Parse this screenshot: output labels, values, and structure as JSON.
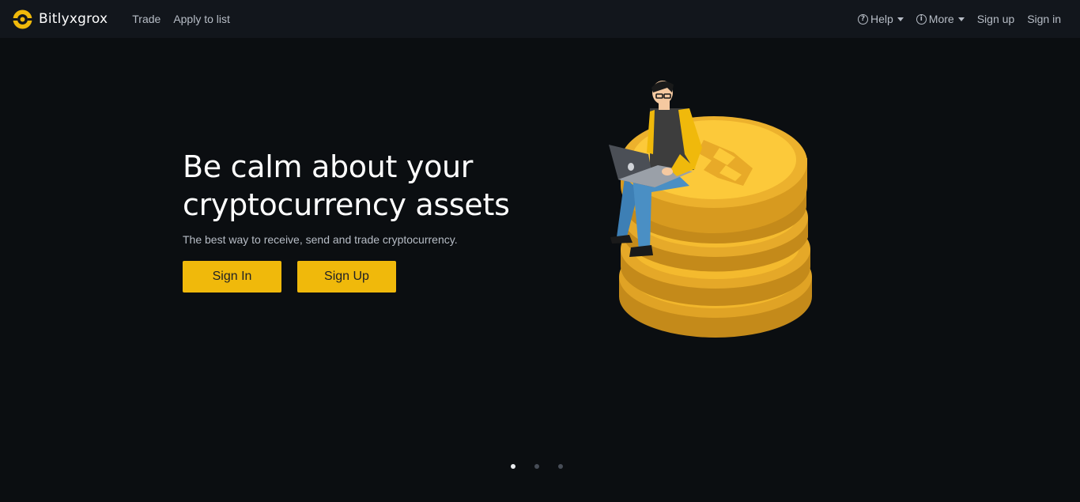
{
  "brand": {
    "name": "Bitlyxgrox"
  },
  "nav": {
    "left": [
      {
        "label": "Trade"
      },
      {
        "label": "Apply to list"
      }
    ],
    "help": {
      "label": "Help",
      "icon": "help-circle-icon"
    },
    "more": {
      "label": "More",
      "icon": "info-circle-icon"
    },
    "signup": "Sign up",
    "signin": "Sign in"
  },
  "hero": {
    "title": "Be calm about your cryptocurrency assets",
    "subtitle": "The best way to receive, send and trade cryptocurrency.",
    "signin_button": "Sign In",
    "signup_button": "Sign Up"
  },
  "carousel": {
    "slides": 3,
    "active": 1
  },
  "colors": {
    "background": "#0b0e11",
    "navbar": "#12161c",
    "accent": "#f0b90b",
    "text_primary": "#ffffff",
    "text_secondary": "#b7bdc6"
  }
}
